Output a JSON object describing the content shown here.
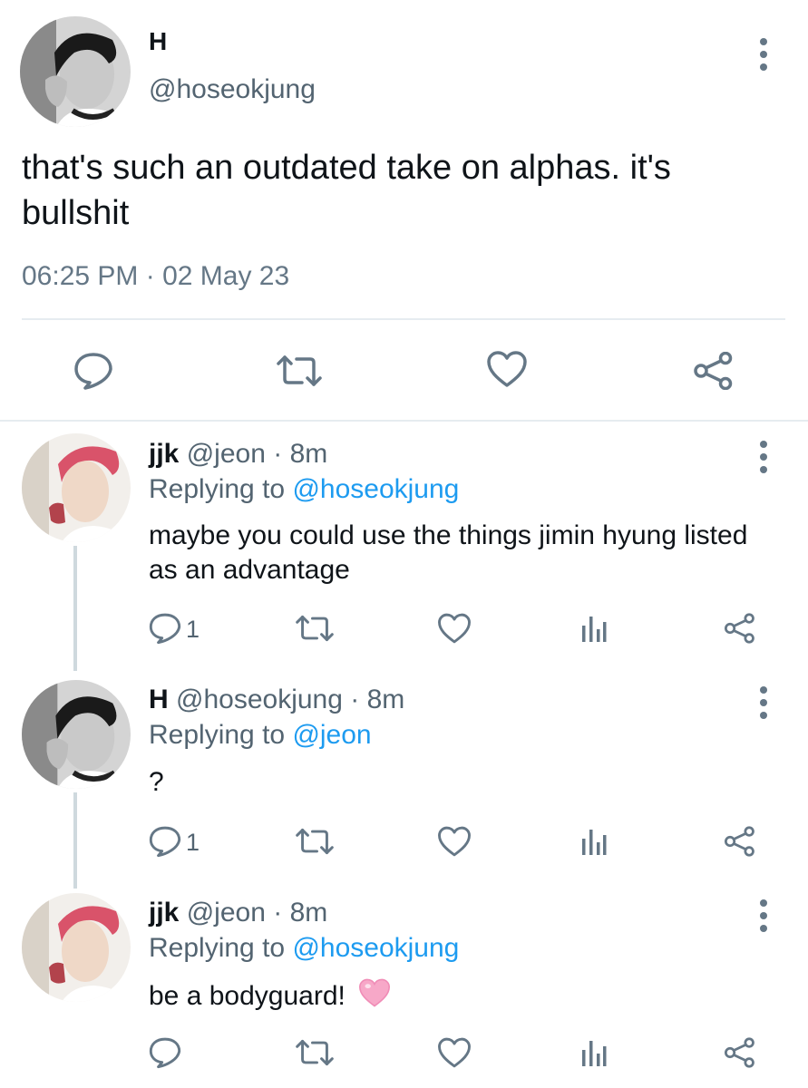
{
  "main_tweet": {
    "name": "H",
    "handle": "@hoseokjung",
    "text": "that's such an outdated take on alphas. it's bullshit",
    "timestamp": "06:25 PM · 02 May 23",
    "avatar": "bw-photo-avatar"
  },
  "action_icons": {
    "reply": "reply-bubble-icon",
    "retweet": "retweet-arrows-icon",
    "like": "heart-icon",
    "share": "share-nodes-icon",
    "analytics": "bar-chart-icon",
    "more": "more-vertical-icon"
  },
  "replies": [
    {
      "name": "jjk",
      "handle": "@jeon",
      "time": "8m",
      "replying_prefix": "Replying to",
      "replying_to": "@hoseokjung",
      "text": "maybe you could use the things jimin hyung listed as an advantage",
      "reply_count": "1",
      "avatar": "red-hair-photo-avatar"
    },
    {
      "name": "H",
      "handle": "@hoseokjung",
      "time": "8m",
      "replying_prefix": "Replying to",
      "replying_to": "@jeon",
      "text": "?",
      "reply_count": "1",
      "avatar": "bw-photo-avatar"
    },
    {
      "name": "jjk",
      "handle": "@jeon",
      "time": "8m",
      "replying_prefix": "Replying to",
      "replying_to": "@hoseokjung",
      "text": "be a bodyguard!",
      "emoji": "pink-heart",
      "avatar": "red-hair-photo-avatar"
    }
  ],
  "colors": {
    "text": "#0f1419",
    "secondary": "#536471",
    "link": "#1d9bf0",
    "divider": "#e6ecf0",
    "icon": "#657786"
  }
}
